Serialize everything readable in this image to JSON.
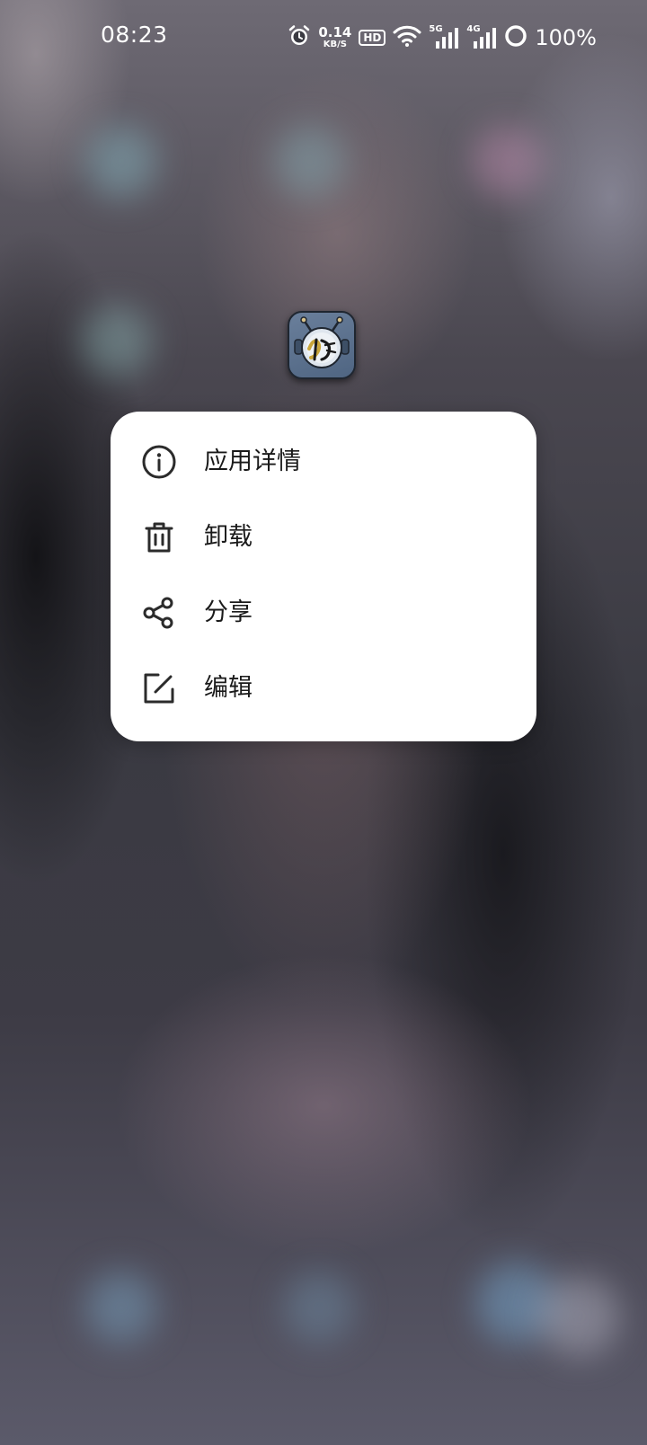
{
  "status_bar": {
    "time": "08:23",
    "net_speed_value": "0.14",
    "net_speed_unit": "KB/S",
    "hd_badge": "HD",
    "signal1_tag": "5G",
    "signal2_tag": "4G",
    "battery": "100%",
    "icons": [
      "alarm-icon",
      "hd-voice-icon",
      "wifi-icon",
      "signal-5g-icon",
      "signal-4g-icon",
      "battery-ring-icon"
    ]
  },
  "app_icon": {
    "name": "app-icon",
    "colors": {
      "background": "#5b708d",
      "face": "#dfe6ee"
    }
  },
  "context_menu": {
    "items": [
      {
        "label": "应用详情",
        "icon": "info-icon"
      },
      {
        "label": "卸载",
        "icon": "trash-icon"
      },
      {
        "label": "分享",
        "icon": "share-icon"
      },
      {
        "label": "编辑",
        "icon": "edit-icon"
      }
    ]
  },
  "colors": {
    "menu_background": "#ffffff",
    "menu_text": "#1a1a1a",
    "status_text": "#ffffff"
  }
}
